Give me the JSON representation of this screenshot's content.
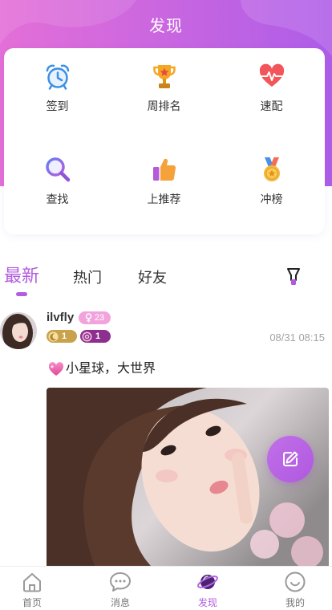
{
  "header": {
    "title": "发现"
  },
  "features": [
    {
      "icon": "alarm-clock-icon",
      "label": "签到"
    },
    {
      "icon": "trophy-icon",
      "label": "周排名"
    },
    {
      "icon": "heart-pulse-icon",
      "label": "速配"
    },
    {
      "icon": "search-icon",
      "label": "查找"
    },
    {
      "icon": "thumbs-up-icon",
      "label": "上推荐"
    },
    {
      "icon": "medal-icon",
      "label": "冲榜"
    }
  ],
  "tabs": [
    {
      "label": "最新",
      "active": true
    },
    {
      "label": "热门",
      "active": false
    },
    {
      "label": "好友",
      "active": false
    }
  ],
  "filter_icon": "filter-icon",
  "post": {
    "username": "ilvfly",
    "gender_icon": "female-icon",
    "age": "23",
    "badges": [
      {
        "icon": "moon-icon",
        "value": "1"
      },
      {
        "icon": "flower-icon",
        "value": "1"
      }
    ],
    "time": "08/31 08:15",
    "text_icon": "sparkling-heart-icon",
    "text": "小星球，大世界"
  },
  "fab_icon": "edit-icon",
  "nav": [
    {
      "icon": "home-icon",
      "label": "首页",
      "active": false
    },
    {
      "icon": "chat-icon",
      "label": "消息",
      "active": false
    },
    {
      "icon": "planet-icon",
      "label": "发现",
      "active": true
    },
    {
      "icon": "smile-icon",
      "label": "我的",
      "active": false
    }
  ],
  "colors": {
    "header_gradient_start": "#e46fd8",
    "header_gradient_end": "#ae5de8",
    "accent": "#b25de0",
    "gender_badge": "#f2a3dc",
    "moon_badge": "#c9a24c",
    "flower_badge": "#8d2f8f",
    "fab": "#c170e8",
    "time_text": "#a3a3a3"
  }
}
